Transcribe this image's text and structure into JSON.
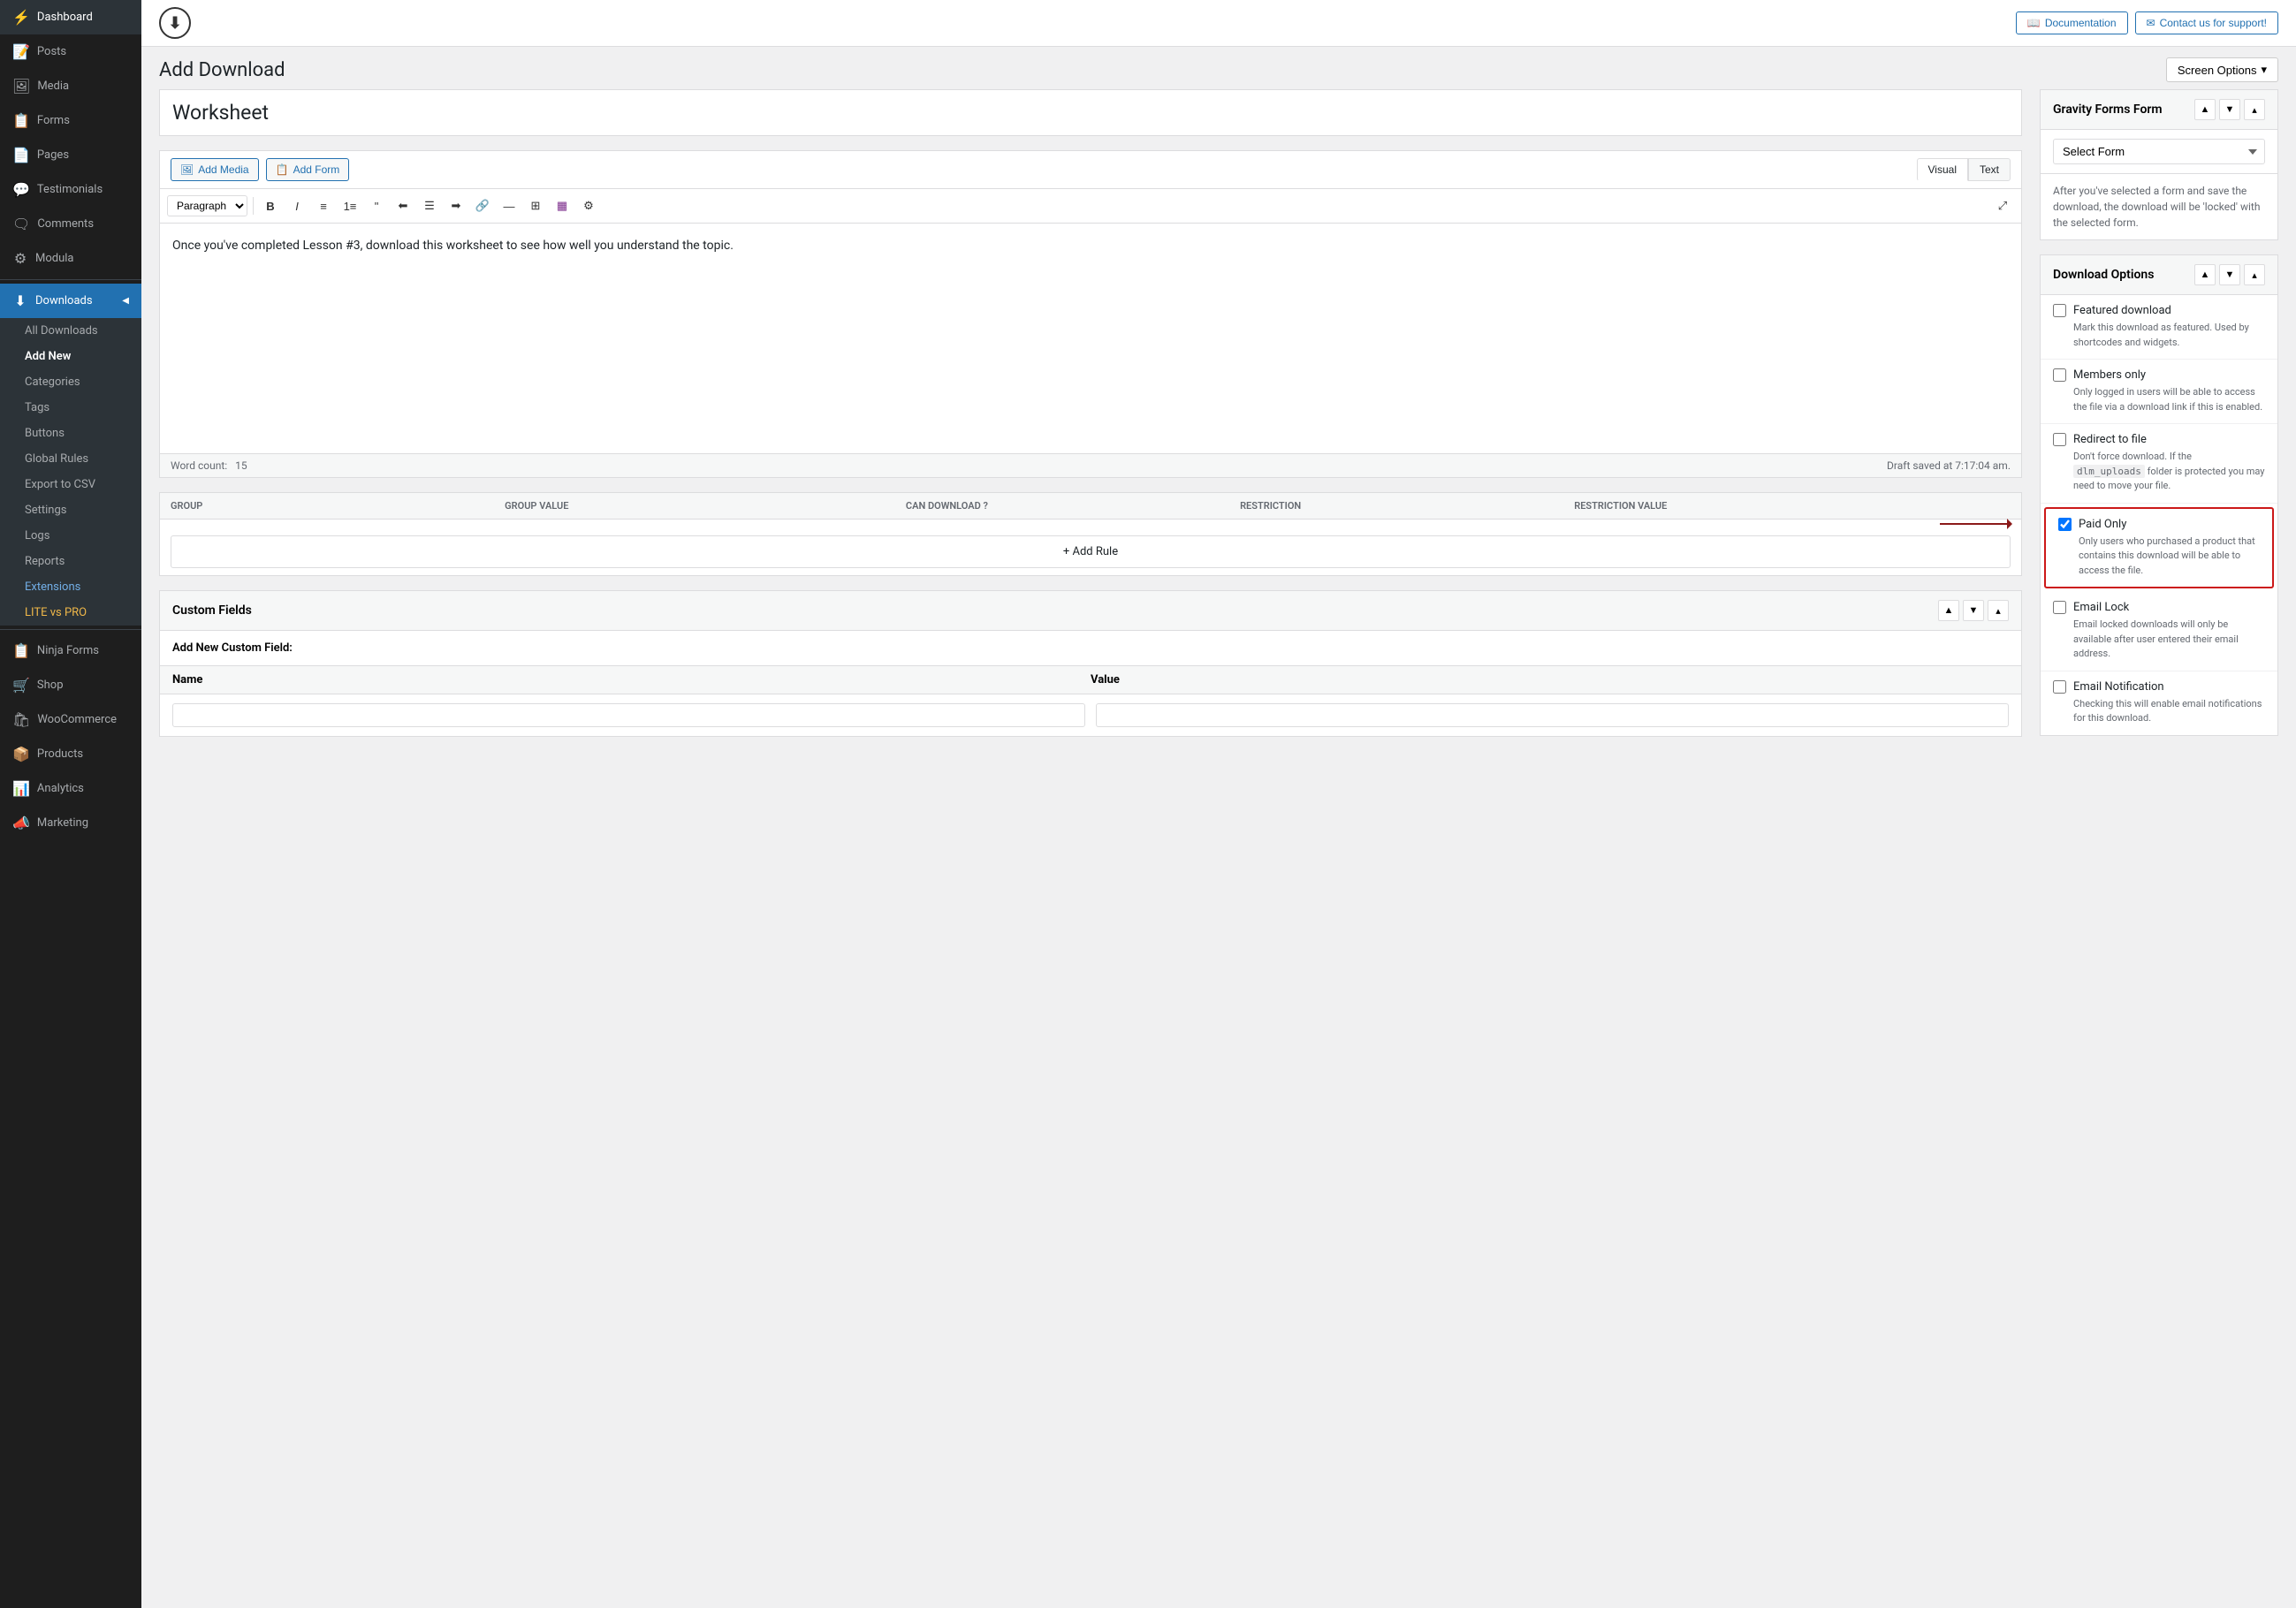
{
  "sidebar": {
    "items": [
      {
        "id": "dashboard",
        "label": "Dashboard",
        "icon": "⚡"
      },
      {
        "id": "posts",
        "label": "Posts",
        "icon": "📝"
      },
      {
        "id": "media",
        "label": "Media",
        "icon": "🖼"
      },
      {
        "id": "forms",
        "label": "Forms",
        "icon": "📋"
      },
      {
        "id": "pages",
        "label": "Pages",
        "icon": "📄"
      },
      {
        "id": "testimonials",
        "label": "Testimonials",
        "icon": "💬"
      },
      {
        "id": "comments",
        "label": "Comments",
        "icon": "🗨"
      },
      {
        "id": "modula",
        "label": "Modula",
        "icon": "⚙"
      }
    ],
    "downloads": {
      "parent": "Downloads",
      "sub": [
        {
          "id": "all-downloads",
          "label": "All Downloads",
          "active": false
        },
        {
          "id": "add-new",
          "label": "Add New",
          "active": true
        },
        {
          "id": "categories",
          "label": "Categories"
        },
        {
          "id": "tags",
          "label": "Tags"
        },
        {
          "id": "buttons",
          "label": "Buttons"
        },
        {
          "id": "global-rules",
          "label": "Global Rules"
        },
        {
          "id": "export-to-csv",
          "label": "Export to CSV"
        },
        {
          "id": "settings",
          "label": "Settings"
        },
        {
          "id": "logs",
          "label": "Logs"
        },
        {
          "id": "reports",
          "label": "Reports"
        },
        {
          "id": "extensions",
          "label": "Extensions",
          "highlight": true
        },
        {
          "id": "lite-vs-pro",
          "label": "LITE vs PRO",
          "liteVsPro": true
        }
      ]
    },
    "bottom_items": [
      {
        "id": "ninja-forms",
        "label": "Ninja Forms",
        "icon": "📋"
      },
      {
        "id": "shop",
        "label": "Shop",
        "icon": "🛒"
      },
      {
        "id": "woocommerce",
        "label": "WooCommerce",
        "icon": "🛍"
      },
      {
        "id": "products",
        "label": "Products",
        "icon": "📦"
      },
      {
        "id": "analytics",
        "label": "Analytics",
        "icon": "📊"
      },
      {
        "id": "marketing",
        "label": "Marketing",
        "icon": "📣"
      }
    ]
  },
  "topbar": {
    "doc_btn": "Documentation",
    "contact_btn": "Contact us for support!",
    "logo_symbol": "⬇"
  },
  "page": {
    "title": "Add Download",
    "screen_options": "Screen Options"
  },
  "editor": {
    "title_placeholder": "Worksheet",
    "title_value": "Worksheet",
    "add_media": "Add Media",
    "add_form": "Add Form",
    "tab_visual": "Visual",
    "tab_text": "Text",
    "format_options": [
      "Paragraph"
    ],
    "content": "Once you've completed Lesson #3, download this worksheet to see how well you understand the topic.",
    "word_count_label": "Word count:",
    "word_count": "15",
    "draft_saved": "Draft saved at 7:17:04 am."
  },
  "rules_table": {
    "columns": [
      "GROUP",
      "GROUP VALUE",
      "CAN DOWNLOAD ?",
      "RESTRICTION",
      "RESTRICTION VALUE"
    ],
    "add_rule_label": "+ Add Rule"
  },
  "custom_fields": {
    "title": "Custom Fields",
    "add_new_label": "Add New Custom Field:",
    "col_name": "Name",
    "col_value": "Value"
  },
  "gravity_forms": {
    "title": "Gravity Forms Form",
    "select_placeholder": "Select Form",
    "note": "After you've selected a form and save the download, the download will be 'locked' with the selected form."
  },
  "download_options": {
    "title": "Download Options",
    "options": [
      {
        "id": "featured",
        "label": "Featured download",
        "checked": false,
        "desc": "Mark this download as featured. Used by shortcodes and widgets.",
        "highlighted": false
      },
      {
        "id": "members-only",
        "label": "Members only",
        "checked": false,
        "desc": "Only logged in users will be able to access the file via a download link if this is enabled.",
        "highlighted": false
      },
      {
        "id": "redirect-to-file",
        "label": "Redirect to file",
        "checked": false,
        "desc_parts": [
          "Don't force download. If the ",
          "dlm_uploads",
          " folder is protected you may need to move your file."
        ],
        "highlighted": false,
        "has_code": true
      },
      {
        "id": "paid-only",
        "label": "Paid Only",
        "checked": true,
        "desc": "Only users who purchased a product that contains this download will be able to access the file.",
        "highlighted": true
      },
      {
        "id": "email-lock",
        "label": "Email Lock",
        "checked": false,
        "desc": "Email locked downloads will only be available after user entered their email address.",
        "highlighted": false
      },
      {
        "id": "email-notification",
        "label": "Email Notification",
        "checked": false,
        "desc": "Checking this will enable email notifications for this download.",
        "highlighted": false
      }
    ]
  }
}
